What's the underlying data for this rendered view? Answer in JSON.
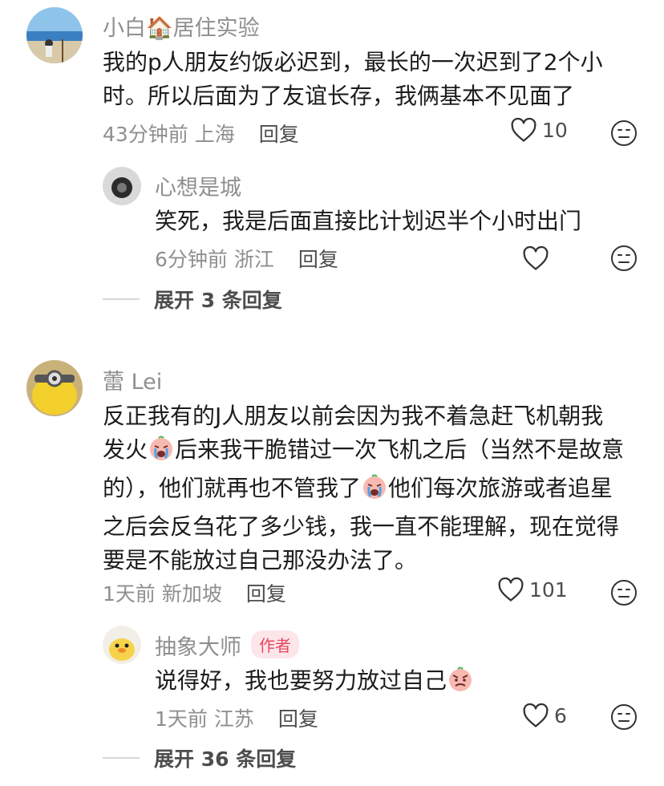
{
  "comments": [
    {
      "username": "小白🏠居住实验",
      "text": "我的p人朋友约饭必迟到，最长的一次迟到了2个小时。所以后面为了友谊长存，我俩基本不见面了",
      "time": "43分钟前",
      "location": "上海",
      "reply_label": "回复",
      "likes": "10"
    },
    {
      "username": "心想是城",
      "text": "笑死，我是后面直接比计划迟半个小时出门",
      "time": "6分钟前",
      "location": "浙江",
      "reply_label": "回复",
      "likes": ""
    },
    {
      "username": "蕾 Lei",
      "text_lines": [
        "反正我有的J人朋友以前会因为我不着急赶飞机朝我",
        "后来我干脆错过一次飞机之后（当然不是故意",
        "的），他们就再也不管我了",
        "他们每次旅游或者追星",
        "之后会反刍花了多少钱，我一直不能理解，现在觉得",
        "要是不能放过自己那没办法了。"
      ],
      "line2_prefix": "发火",
      "time": "1天前",
      "location": "新加坡",
      "reply_label": "回复",
      "likes": "101"
    },
    {
      "username": "抽象大师",
      "badge": "作者",
      "text": "说得好，我也要努力放过自己",
      "time": "1天前",
      "location": "江苏",
      "reply_label": "回复",
      "likes": "6"
    }
  ],
  "expand_1": "展开 3 条回复",
  "expand_2": "展开 36 条回复",
  "icons": {
    "like": "heart-outline-icon",
    "dislike": "neutral-face-icon"
  },
  "colors": {
    "meta": "#8f8f8f",
    "text": "#1c1c1c",
    "badge_bg": "#fde6ea",
    "badge_text": "#e8475e"
  }
}
